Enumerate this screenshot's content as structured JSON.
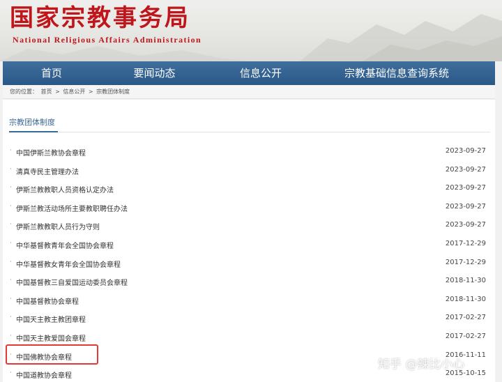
{
  "header": {
    "logo_cn": "国家宗教事务局",
    "logo_en": "National Religious Affairs Administration"
  },
  "nav": {
    "items": [
      {
        "label": "首页"
      },
      {
        "label": "要闻动态"
      },
      {
        "label": "信息公开"
      },
      {
        "label": "宗教基础信息查询系统"
      }
    ]
  },
  "breadcrumb": {
    "prefix": "您的位置：",
    "items": [
      "首页",
      "信息公开",
      "宗教团体制度"
    ],
    "separator": ">"
  },
  "section": {
    "title": "宗教团体制度"
  },
  "documents": [
    {
      "title": "中国伊斯兰教协会章程",
      "date": "2023-09-27"
    },
    {
      "title": "清真寺民主管理办法",
      "date": "2023-09-27"
    },
    {
      "title": "伊斯兰教教职人员资格认定办法",
      "date": "2023-09-27"
    },
    {
      "title": "伊斯兰教活动场所主要教职聘任办法",
      "date": "2023-09-27"
    },
    {
      "title": "伊斯兰教教职人员行为守则",
      "date": "2023-09-27"
    },
    {
      "title": "中华基督教青年会全国协会章程",
      "date": "2017-12-29"
    },
    {
      "title": "中华基督教女青年会全国协会章程",
      "date": "2017-12-29"
    },
    {
      "title": "中国基督教三自爱国运动委员会章程",
      "date": "2018-11-30"
    },
    {
      "title": "中国基督教协会章程",
      "date": "2018-11-30"
    },
    {
      "title": "中国天主教主教团章程",
      "date": "2017-02-27"
    },
    {
      "title": "中国天主教爱国会章程",
      "date": "2017-02-27"
    },
    {
      "title": "中国佛教协会章程",
      "date": "2016-11-11"
    },
    {
      "title": "中国道教协会章程",
      "date": "2015-10-15"
    }
  ],
  "watermark": "知乎 @辣比小心",
  "colors": {
    "brand_red": "#c0161b",
    "nav_blue": "#2a5787",
    "highlight_red": "#e53935"
  }
}
